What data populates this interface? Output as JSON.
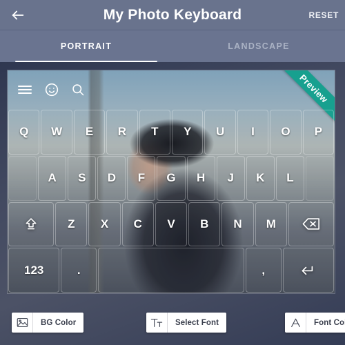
{
  "header": {
    "back_icon": "arrow-left-icon",
    "title": "My Photo Keyboard",
    "reset_label": "RESET",
    "bg_color": "#69738d"
  },
  "tabs": {
    "items": [
      {
        "label": "PORTRAIT",
        "active": true
      },
      {
        "label": "LANDSCAPE",
        "active": false
      }
    ]
  },
  "preview": {
    "ribbon_label": "Preview",
    "ribbon_color": "#17a08f",
    "toolbar_icons": [
      "menu-icon",
      "emoji-icon",
      "search-icon"
    ]
  },
  "keyboard": {
    "row1": [
      "Q",
      "W",
      "E",
      "R",
      "T",
      "Y",
      "U",
      "I",
      "O",
      "P"
    ],
    "row2": [
      "A",
      "S",
      "D",
      "F",
      "G",
      "H",
      "J",
      "K",
      "L"
    ],
    "row3_shift": "shift-icon",
    "row3": [
      "Z",
      "X",
      "C",
      "V",
      "B",
      "N",
      "M"
    ],
    "row3_backspace": "backspace-icon",
    "row4_numeric": "123",
    "row4_period": ".",
    "row4_space": "",
    "row4_comma": ",",
    "row4_enter": "enter-icon"
  },
  "bottom_toolbar": {
    "buttons": [
      {
        "icon": "image-icon",
        "label": "BG Color"
      },
      {
        "icon": "text-format-icon",
        "label": "Select Font"
      },
      {
        "icon": "font-color-icon",
        "label": "Font Color"
      }
    ]
  },
  "colors": {
    "header": "#69738d",
    "tab_bar": "#6a7490",
    "accent_ribbon": "#17a08f",
    "active_tab_text": "#ffffff",
    "inactive_tab_text": "#aab2c4"
  }
}
